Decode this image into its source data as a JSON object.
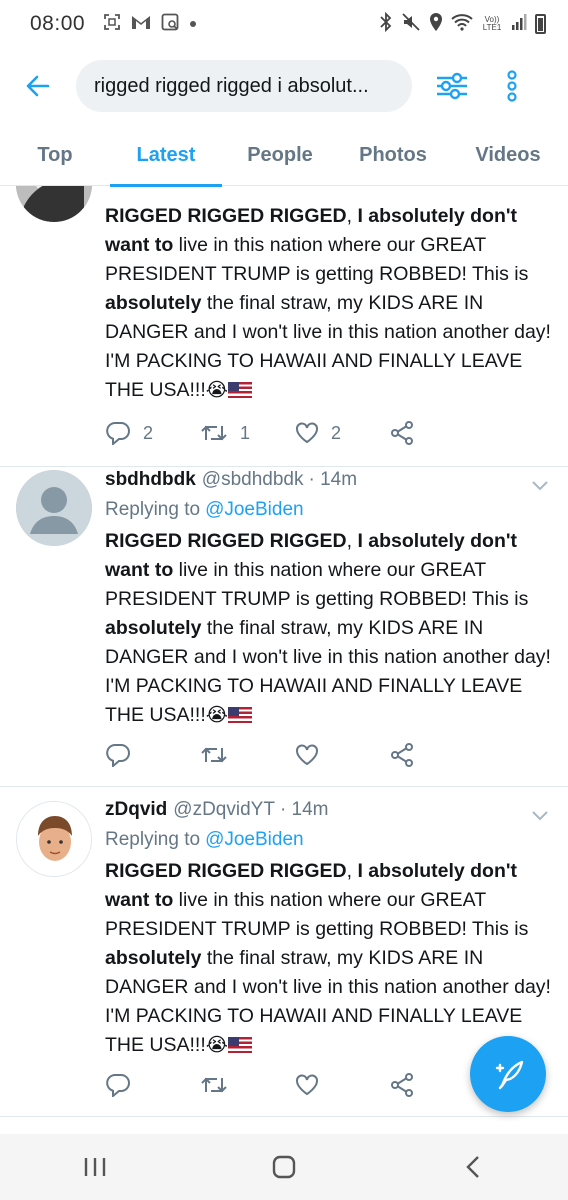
{
  "status_bar": {
    "time": "08:00",
    "left_icons": [
      "screenshot-icon",
      "gmail-icon",
      "gallery-icon",
      "dot-icon"
    ],
    "right_icons": [
      "bluetooth-icon",
      "mute-icon",
      "location-icon",
      "wifi-icon",
      "volte-icon",
      "signal-icon",
      "battery-icon"
    ],
    "volte_label": "Vo)) LTE1"
  },
  "header": {
    "search_query": "rigged rigged rigged i absolut..."
  },
  "tabs": [
    {
      "label": "Top",
      "active": false
    },
    {
      "label": "Latest",
      "active": true
    },
    {
      "label": "People",
      "active": false
    },
    {
      "label": "Photos",
      "active": false
    },
    {
      "label": "Videos",
      "active": false
    }
  ],
  "tweets": [
    {
      "name": "",
      "handle": "",
      "time": "",
      "replying_to_label": "",
      "replying_to": "",
      "text": {
        "p1": "RIGGED RIGGED RIGGED",
        "p2": ", ",
        "p3": "I absolutely don't want to",
        "p4": " live in this nation where our GREAT PRESIDENT TRUMP is getting ROBBED! This is ",
        "p5": "absolutely",
        "p6": " the final straw, my KIDS ARE IN DANGER and I won't live in this nation another day! I'M PACKING TO HAWAII AND FINALLY LEAVE THE USA!!!"
      },
      "reply_count": "2",
      "retweet_count": "1",
      "like_count": "2"
    },
    {
      "name": "sbdhdbdk",
      "handle": "@sbdhdbdk",
      "time": "· 14m",
      "replying_to_label": "Replying to",
      "replying_to": "@JoeBiden",
      "text": {
        "p1": "RIGGED RIGGED RIGGED",
        "p2": ", ",
        "p3": "I absolutely don't want to",
        "p4": " live in this nation where our GREAT PRESIDENT TRUMP is getting ROBBED! This is ",
        "p5": "absolutely",
        "p6": " the final straw, my KIDS ARE IN DANGER and I won't live in this nation another day! I'M PACKING TO HAWAII AND FINALLY LEAVE THE USA!!!"
      },
      "reply_count": "",
      "retweet_count": "",
      "like_count": ""
    },
    {
      "name": "zDqvid",
      "handle": "@zDqvidYT",
      "time": "· 14m",
      "replying_to_label": "Replying to",
      "replying_to": "@JoeBiden",
      "text": {
        "p1": "RIGGED RIGGED RIGGED",
        "p2": ", ",
        "p3": "I absolutely don't want to",
        "p4": " live in this nation where our GREAT PRESIDENT TRUMP is getting ROBBED! This is ",
        "p5": "absolutely",
        "p6": " the final straw, my KIDS ARE IN DANGER and I won't live in this nation another day! I'M PACKING TO HAWAII AND FINALLY LEAVE THE USA!!!"
      },
      "reply_count": "",
      "retweet_count": "",
      "like_count": ""
    }
  ],
  "emoji": {
    "crying": "😭"
  },
  "colors": {
    "accent": "#1da1f2",
    "muted": "#657786",
    "text": "#14171a"
  }
}
